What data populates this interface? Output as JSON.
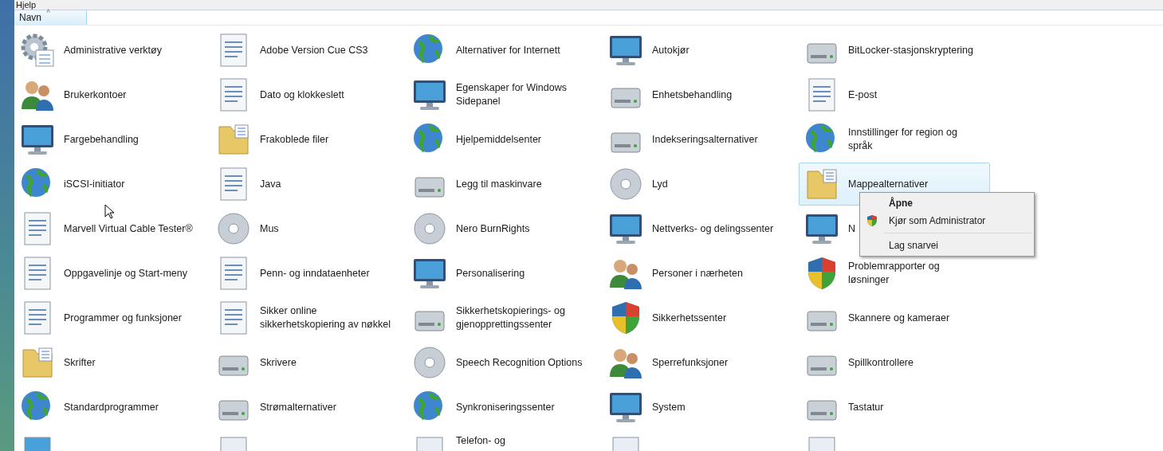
{
  "menu_bar": {
    "items": [
      "Hjelp"
    ]
  },
  "column_header": {
    "label": "Navn",
    "sort_arrow": "˄"
  },
  "items": [
    {
      "label": "Administrative verktøy",
      "selected": false
    },
    {
      "label": "Adobe Version Cue CS3",
      "selected": false
    },
    {
      "label": "Alternativer for Internett",
      "selected": false
    },
    {
      "label": "Autokjør",
      "selected": false
    },
    {
      "label": "BitLocker-stasjonskryptering",
      "selected": false
    },
    {
      "label": "Brukerkontoer",
      "selected": false
    },
    {
      "label": "Dato og klokkeslett",
      "selected": false
    },
    {
      "label": "Egenskaper for Windows Sidepanel",
      "selected": false
    },
    {
      "label": "Enhetsbehandling",
      "selected": false
    },
    {
      "label": "E-post",
      "selected": false
    },
    {
      "label": "Fargebehandling",
      "selected": false
    },
    {
      "label": "Frakoblede filer",
      "selected": false
    },
    {
      "label": "Hjelpemiddelsenter",
      "selected": false
    },
    {
      "label": "Indekseringsalternativer",
      "selected": false
    },
    {
      "label": "Innstillinger for region og språk",
      "selected": false
    },
    {
      "label": "iSCSI-initiator",
      "selected": false
    },
    {
      "label": "Java",
      "selected": false
    },
    {
      "label": "Legg til maskinvare",
      "selected": false
    },
    {
      "label": "Lyd",
      "selected": false
    },
    {
      "label": "Mappealternativer",
      "selected": true
    },
    {
      "label": "Marvell Virtual Cable Tester®",
      "selected": false
    },
    {
      "label": "Mus",
      "selected": false
    },
    {
      "label": "Nero BurnRights",
      "selected": false
    },
    {
      "label": "Nettverks- og delingssenter",
      "selected": false
    },
    {
      "label": "N",
      "selected": false
    },
    {
      "label": "Oppgavelinje og Start-meny",
      "selected": false
    },
    {
      "label": "Penn- og inndataenheter",
      "selected": false
    },
    {
      "label": "Personalisering",
      "selected": false
    },
    {
      "label": "Personer i nærheten",
      "selected": false
    },
    {
      "label": "Problemrapporter og løsninger",
      "selected": false
    },
    {
      "label": "Programmer og funksjoner",
      "selected": false
    },
    {
      "label": "Sikker online sikkerhetskopiering av nøkkel",
      "selected": false
    },
    {
      "label": "Sikkerhetskopierings- og gjenopprettingssenter",
      "selected": false
    },
    {
      "label": "Sikkerhetssenter",
      "selected": false
    },
    {
      "label": "Skannere og kameraer",
      "selected": false
    },
    {
      "label": "Skrifter",
      "selected": false
    },
    {
      "label": "Skrivere",
      "selected": false
    },
    {
      "label": "Speech Recognition Options",
      "selected": false
    },
    {
      "label": "Sperrefunksjoner",
      "selected": false
    },
    {
      "label": "Spillkontrollere",
      "selected": false
    },
    {
      "label": "Standardprogrammer",
      "selected": false
    },
    {
      "label": "Strømalternativer",
      "selected": false
    },
    {
      "label": "Synkroniseringssenter",
      "selected": false
    },
    {
      "label": "System",
      "selected": false
    },
    {
      "label": "Tastatur",
      "selected": false
    }
  ],
  "partial_row": {
    "label": "Telefon- og"
  },
  "context_menu": {
    "items": [
      {
        "kind": "item",
        "label": "Åpne",
        "default": true,
        "shield": false
      },
      {
        "kind": "item",
        "label": "Kjør som Administrator",
        "default": false,
        "shield": true
      },
      {
        "kind": "separator"
      },
      {
        "kind": "item",
        "label": "Lag snarvei",
        "default": false,
        "shield": false
      }
    ]
  }
}
